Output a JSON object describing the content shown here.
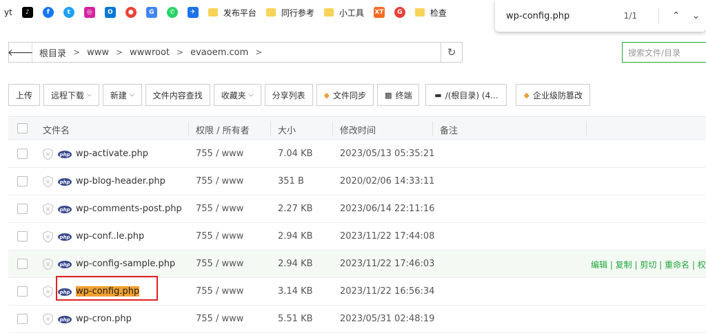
{
  "bookmarks": [
    {
      "label": "yt"
    },
    {
      "icon": "tiktok-icon",
      "color": "#000000"
    },
    {
      "icon": "facebook-icon",
      "color": "#1877f2"
    },
    {
      "icon": "twitter-icon",
      "color": "#1da1f2"
    },
    {
      "icon": "instagram-icon",
      "color": "#d6249f"
    },
    {
      "icon": "outlook-icon",
      "color": "#0078d4"
    },
    {
      "icon": "chrome-icon",
      "color": "#ea4335"
    },
    {
      "icon": "translate-icon",
      "color": "#4285f4"
    },
    {
      "icon": "whatsapp-icon",
      "color": "#25d366"
    },
    {
      "icon": "bird-icon",
      "color": "#1a73e8"
    },
    {
      "folder": true,
      "label": "发布平台"
    },
    {
      "folder": true,
      "label": "同行参考"
    },
    {
      "folder": true,
      "label": "小工具"
    },
    {
      "icon": "xt-icon",
      "color": "#f26b21",
      "text": "XT"
    },
    {
      "icon": "app-icon",
      "color": "#e8413a"
    },
    {
      "folder": true,
      "label": "检查"
    }
  ],
  "find": {
    "query": "wp-config.php",
    "count": "1/1",
    "up": "⌃",
    "down": "⌄"
  },
  "path": {
    "crumbs": [
      "根目录",
      "www",
      "wwwroot",
      "evaoem.com"
    ],
    "back": "🡐",
    "refresh": "↻",
    "search_placeholder": "搜索文件/目录"
  },
  "toolbar": {
    "upload": "上传",
    "remote_download": "远程下载",
    "new": "新建",
    "content_search": "文件内容查找",
    "favorites": "收藏夹",
    "share_list": "分享列表",
    "file_sync": "文件同步",
    "terminal": "终端",
    "disk": "/(根目录) (4...",
    "tamper": "企业级防篡改"
  },
  "table": {
    "headers": {
      "name": "文件名",
      "perm": "权限 / 所有者",
      "size": "大小",
      "mtime": "修改时间",
      "note": "备注"
    },
    "rows": [
      {
        "name": "wp-activate.php",
        "perm": "755 / www",
        "size": "7.04 KB",
        "mtime": "2023/05/13 05:35:21"
      },
      {
        "name": "wp-blog-header.php",
        "perm": "755 / www",
        "size": "351 B",
        "mtime": "2020/02/06 14:33:11"
      },
      {
        "name": "wp-comments-post.php",
        "perm": "755 / www",
        "size": "2.27 KB",
        "mtime": "2023/06/14 22:11:16"
      },
      {
        "name": "wp-conf..le.php",
        "perm": "755 / www",
        "size": "2.94 KB",
        "mtime": "2023/11/22 17:44:08"
      },
      {
        "name": "wp-config-sample.php",
        "perm": "755 / www",
        "size": "2.94 KB",
        "mtime": "2023/11/22 17:46:03"
      },
      {
        "name": "wp-config.php",
        "perm": "755 / www",
        "size": "3.14 KB",
        "mtime": "2023/11/22 16:56:34"
      },
      {
        "name": "wp-cron.php",
        "perm": "755 / www",
        "size": "5.51 KB",
        "mtime": "2023/05/31 02:48:19"
      }
    ],
    "row_ops": "编辑 | 复制 | 剪切 | 重命名 | 权限",
    "php_badge": "php"
  },
  "colors": {
    "accent": "#20a53a",
    "highlight": "#f0a030",
    "annotation": "#e02020"
  }
}
